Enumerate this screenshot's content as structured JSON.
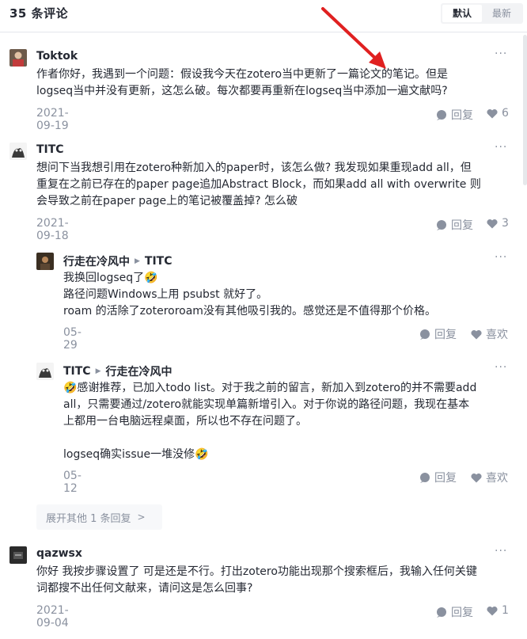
{
  "header": {
    "count_label": "35 条评论",
    "sort_default": "默认",
    "sort_latest": "最新"
  },
  "accent_color": "#e02020",
  "comments": [
    {
      "author": "Toktok",
      "lines": [
        "作者你好，我遇到一个问题：假设我今天在zotero当中更新了一篇论文的笔记。但是",
        "logseq当中并没有更新，这怎么破。每次都要再重新在logseq当中添加一遍文献吗?"
      ],
      "date": "2021-09-19",
      "reply_label": "回复",
      "like_count": "6"
    },
    {
      "author": "TITC",
      "lines": [
        "想问下当我想引用在zotero种新加入的paper时，该怎么做? 我发现如果重现add all，但",
        "重复在之前已存在的paper page追加Abstract Block，而如果add all with overwrite 则",
        "会导致之前在paper page上的笔记被覆盖掉? 怎么破"
      ],
      "date": "2021-09-18",
      "reply_label": "回复",
      "like_count": "3",
      "replies": [
        {
          "author": "行走在冷风中",
          "reply_to": "TITC",
          "lines": [
            "我换回logseq了🤣",
            "路径问题Windows上用 psubst 就好了。",
            "roam 的活除了zoteroroam没有其他吸引我的。感觉还是不值得那个价格。"
          ],
          "date": "05-29",
          "reply_label": "回复",
          "like_label": "喜欢"
        },
        {
          "author": "TITC",
          "reply_to": "行走在冷风中",
          "lines": [
            "🤣感谢推荐，已加入todo list。对于我之前的留言，新加入到zotero的并不需要add",
            "all，只需要通过/zotero就能实现单篇新增引入。对于你说的路径问题，我现在基本",
            "上都用一台电脑远程桌面，所以也不存在问题了。",
            "",
            "logseq确实issue一堆没修🤣"
          ],
          "date": "05-12",
          "reply_label": "回复",
          "like_label": "喜欢"
        }
      ],
      "expand_label": "展开其他 1 条回复"
    },
    {
      "author": "qazwsx",
      "lines": [
        "你好 我按步骤设置了 可是还是不行。打出zotero功能出现那个搜索框后，我输入任何关键",
        "词都搜不出任何文献来，请问这是怎么回事?"
      ],
      "date": "2021-09-04",
      "reply_label": "回复",
      "like_count": "1"
    }
  ]
}
